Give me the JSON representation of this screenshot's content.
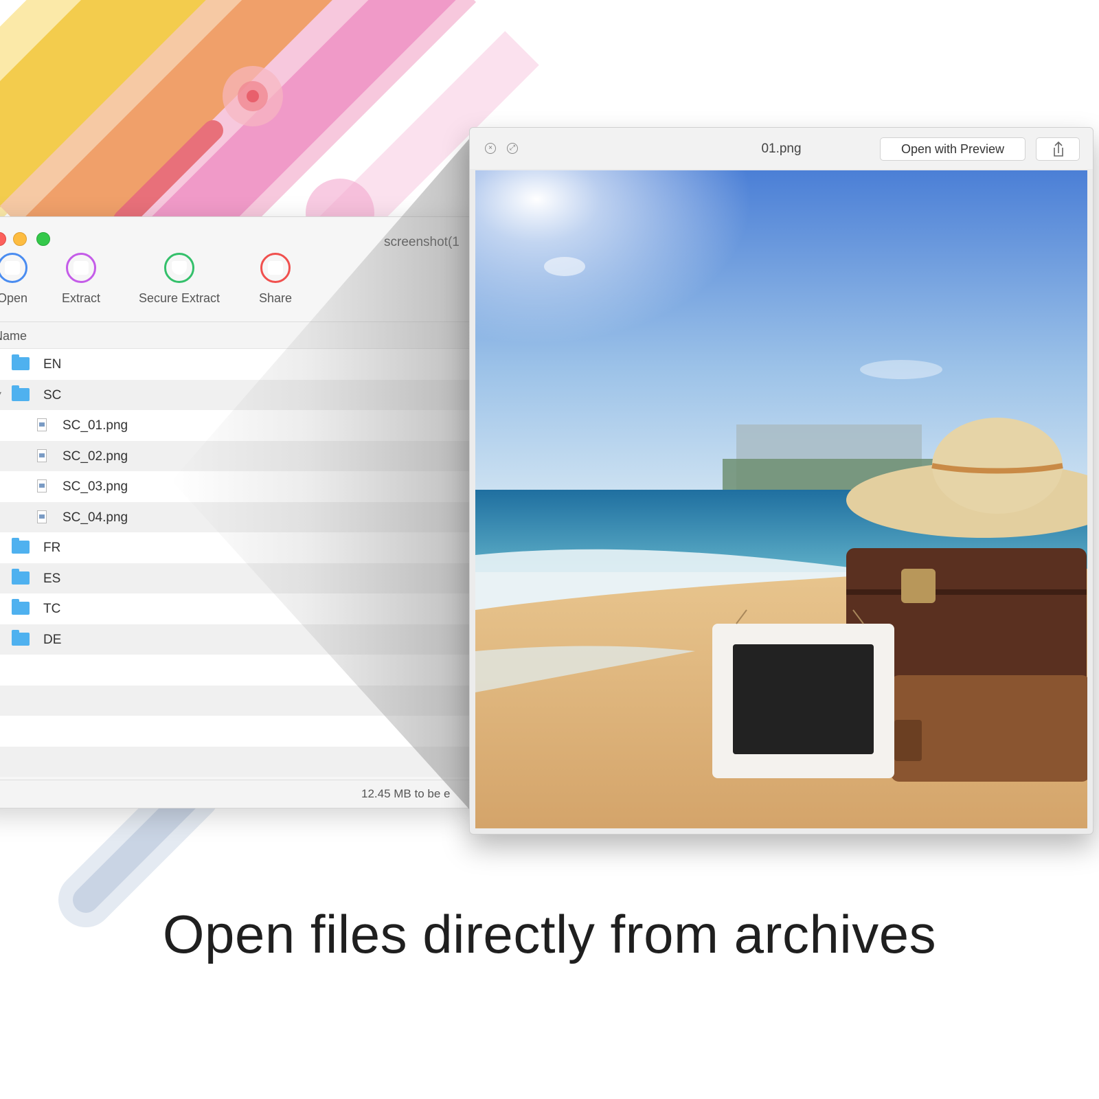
{
  "archive_window": {
    "title": "screenshot(1",
    "toolbar": [
      {
        "label": "Open",
        "icon": "open-archive-icon"
      },
      {
        "label": "Extract",
        "icon": "extract-icon"
      },
      {
        "label": "Secure Extract",
        "icon": "shield-icon"
      },
      {
        "label": "Share",
        "icon": "share-icon"
      }
    ],
    "column_header": "Name",
    "files": [
      {
        "name": "EN",
        "type": "folder"
      },
      {
        "name": "SC",
        "type": "folder"
      },
      {
        "name": "SC_01.png",
        "type": "png"
      },
      {
        "name": "SC_02.png",
        "type": "png"
      },
      {
        "name": "SC_03.png",
        "type": "png"
      },
      {
        "name": "SC_04.png",
        "type": "png"
      },
      {
        "name": "FR",
        "type": "folder"
      },
      {
        "name": "ES",
        "type": "folder"
      },
      {
        "name": "TC",
        "type": "folder"
      },
      {
        "name": "DE",
        "type": "folder"
      }
    ],
    "status": "12.45 MB to be e"
  },
  "quicklook": {
    "title": "01.png",
    "open_with_label": "Open with Preview",
    "share_icon": "share-icon"
  },
  "caption": "Open files directly from archives",
  "colors": {
    "folder_blue": "#4fb1ef",
    "open_blue": "#4a8cf0",
    "extract_purple": "#c45ce8",
    "secure_green": "#34c06b",
    "share_red": "#f0504e",
    "stripe_yellow": "#f3cc4d",
    "stripe_orange": "#f0a06a",
    "stripe_pink": "#f09ac8"
  }
}
